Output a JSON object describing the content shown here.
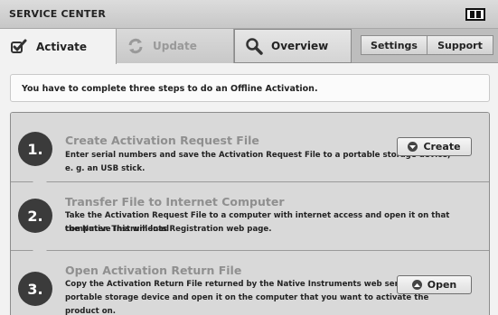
{
  "window": {
    "title": "SERVICE CENTER"
  },
  "tabs": [
    {
      "label": "Activate",
      "icon": "checkmark-icon"
    },
    {
      "label": "Update",
      "icon": "refresh-icon"
    },
    {
      "label": "Overview",
      "icon": "magnifier-icon"
    }
  ],
  "header_buttons": {
    "settings": "Settings",
    "support": "Support"
  },
  "info": {
    "text": "You have to complete three steps to do an Offline Activation."
  },
  "steps": [
    {
      "number": "1.",
      "title": "Create Activation Request File",
      "desc1": "Enter serial numbers and save the Activation Request File to a portable storage device,",
      "desc2": "e. g. an USB stick.",
      "button": "Create",
      "button_icon": "arrow-down-circle-icon"
    },
    {
      "number": "2.",
      "title": "Transfer File to Internet Computer",
      "desc1": "Take the Activation Request File to a computer with internet access and open it on that computer. This will load",
      "desc2": "the Native Instruments Registration web page."
    },
    {
      "number": "3.",
      "title": "Open Activation Return File",
      "desc1": "Copy the Activation Return File returned by the Native Instruments web server to a",
      "desc2": "portable storage device and open it on the computer that you want to activate the",
      "desc3": "product on.",
      "button": "Open",
      "button_icon": "arrow-up-circle-icon"
    }
  ],
  "colors": {
    "accent_dark": "#3b3b3b",
    "step_bg": "#d9d9d9",
    "muted_title": "#8f8f8f"
  }
}
